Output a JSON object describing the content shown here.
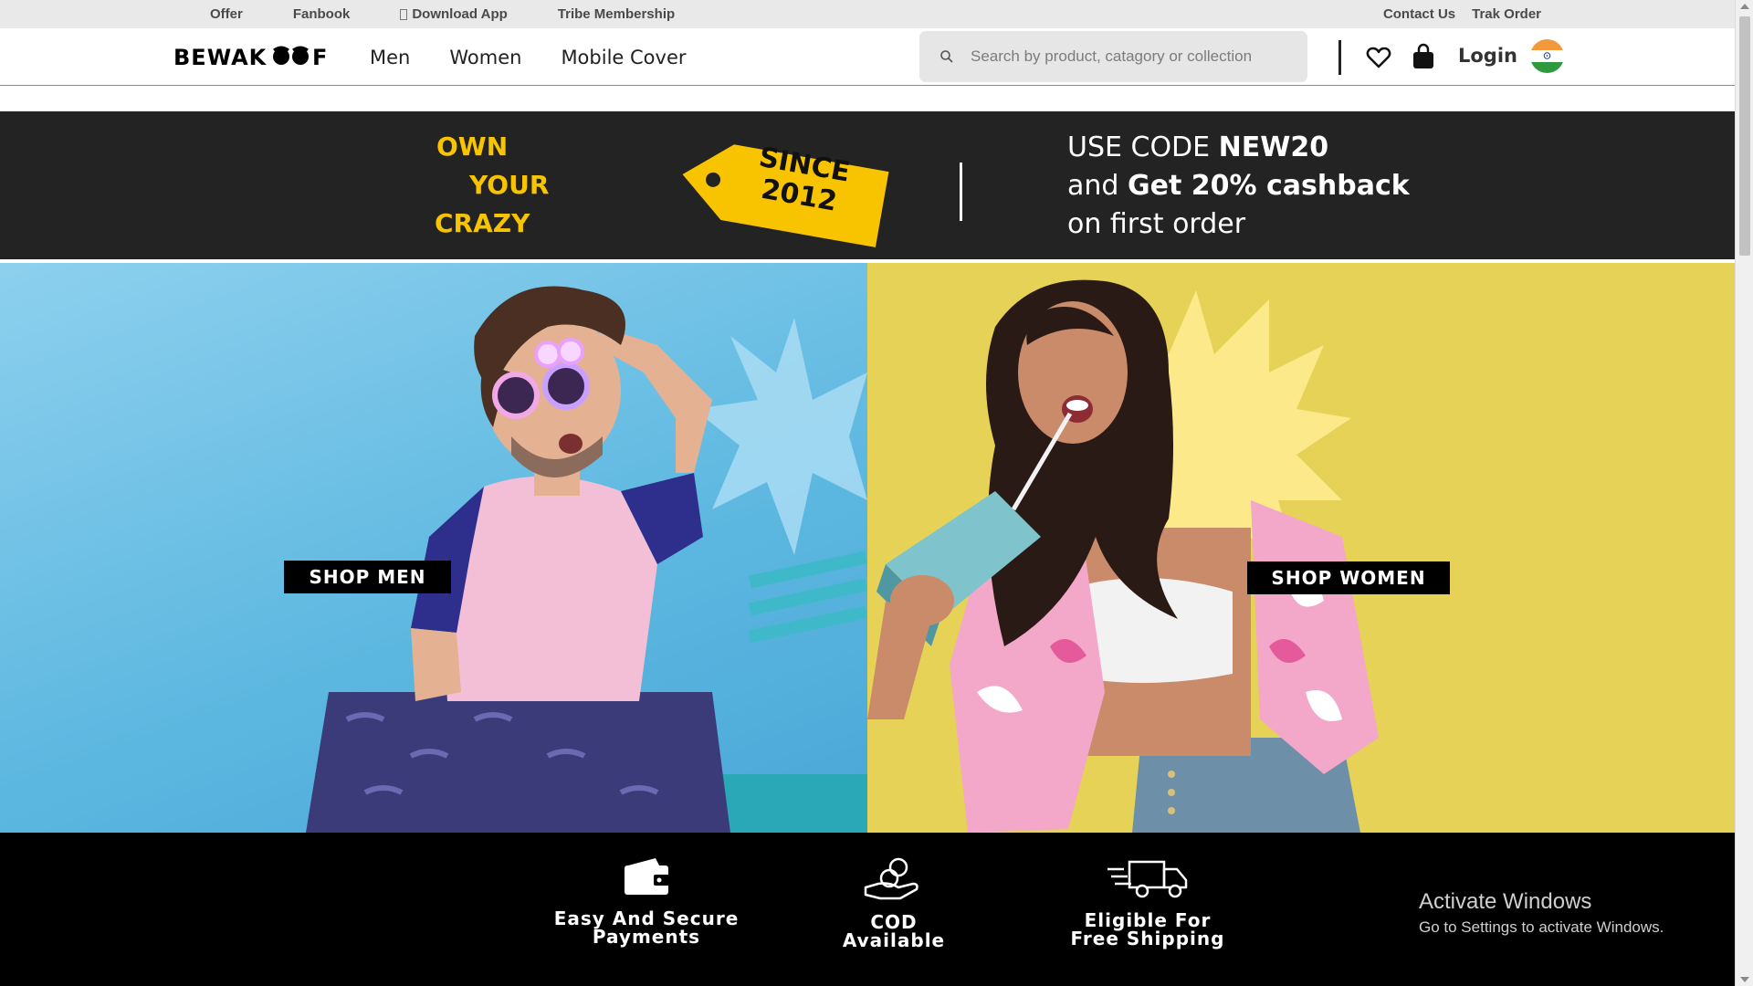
{
  "topbar": {
    "left_links": [
      "Offer",
      "Fanbook",
      "Download App",
      "Tribe Membership"
    ],
    "right_links": [
      "Contact Us",
      "Trak Order"
    ]
  },
  "navbar": {
    "logo": "Bewakoof",
    "links": [
      "Men",
      "Women",
      "Mobile Cover"
    ],
    "search_placeholder": "Search by product, catagory or collection",
    "login_label": "Login",
    "icons": [
      "search-icon",
      "heart-icon",
      "shopping-bag-icon",
      "india-flag-icon"
    ]
  },
  "promo": {
    "tagline": [
      "OWN",
      "YOUR",
      "CRAZY"
    ],
    "since": [
      "SINCE",
      "2012"
    ],
    "code_line1_prefix": "USE CODE ",
    "code": "NEW20",
    "code_line2_prefix": "and ",
    "cashback": "Get 20% cashback",
    "code_line3": "on first order",
    "accent_color": "#f8c400"
  },
  "hero": {
    "men_button": "SHOP MEN",
    "women_button": "SHOP WOMEN",
    "men_bg": "#5cb7e0",
    "women_bg": "#e6d257"
  },
  "features": [
    {
      "icon": "wallet-icon",
      "line1": "Easy And Secure",
      "line2": "Payments"
    },
    {
      "icon": "cash-hand-icon",
      "line1": "COD",
      "line2": "Available"
    },
    {
      "icon": "delivery-truck-icon",
      "line1": "Eligible For",
      "line2": "Free Shipping"
    }
  ],
  "watermark": {
    "title": "Activate Windows",
    "subtitle": "Go to Settings to activate Windows."
  }
}
